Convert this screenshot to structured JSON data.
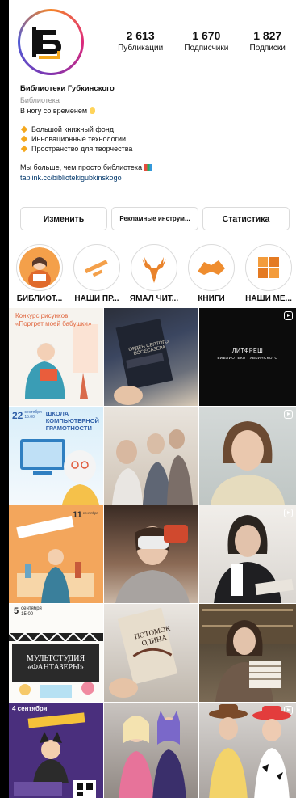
{
  "profile": {
    "stats": [
      {
        "value": "2 613",
        "label": "Публикации"
      },
      {
        "value": "1 670",
        "label": "Подписчики"
      },
      {
        "value": "1 827",
        "label": "Подписки"
      }
    ],
    "name": "Библиотеки Губкинского",
    "category": "Библиотека",
    "tagline": "В ногу со временем",
    "bullets": [
      "Большой книжный фонд",
      "Инновационные технологии",
      "Пространство для творчества"
    ],
    "more": "Мы больше, чем просто библиотека",
    "link": "taplink.cc/bibliotekigubkinskogo",
    "bulb_icon": "light-bulb-icon",
    "books_icon": "books-icon",
    "bullet_icon": "orange-diamond-icon"
  },
  "buttons": {
    "edit": "Изменить",
    "promo": "Рекламные инструм...",
    "stats": "Статистика"
  },
  "highlights": [
    {
      "label": "БИБЛИОТ..."
    },
    {
      "label": "НАШИ ПР..."
    },
    {
      "label": "ЯМАЛ ЧИТ..."
    },
    {
      "label": "КНИГИ"
    },
    {
      "label": "НАШИ МЕ..."
    }
  ],
  "posts": {
    "p1": {
      "title1": "Конкурс рисунков",
      "title2": "«Портрет моей бабушки»"
    },
    "p2": {
      "book": "ОРДЕН СВЯТОГО ВОСЕСАЗЕРА"
    },
    "p3": {
      "title": "ЛИТФРЕШ",
      "sub": "БИБЛИОТЕКИ ГУБКИНСКОГО"
    },
    "p4": {
      "date": "22",
      "month": "сентября",
      "time": "15:00",
      "title": "ШКОЛА КОМПЬЮТЕРНОЙ ГРАМОТНОСТИ"
    },
    "p7": {
      "date": "11",
      "month": "сентября"
    },
    "p10": {
      "date": "5",
      "month": "сентября",
      "time": "15:00",
      "title1": "МУЛЬТСТУДИЯ",
      "title2": "«ФАНТАЗЕРЫ»"
    },
    "p11": {
      "book": "ПОТОМОК ОДИНА"
    },
    "p13": {
      "date": "4 сентября"
    }
  },
  "colors": {
    "accent": "#f4a81d",
    "link": "#00376b",
    "muted": "#8e8e8e"
  }
}
